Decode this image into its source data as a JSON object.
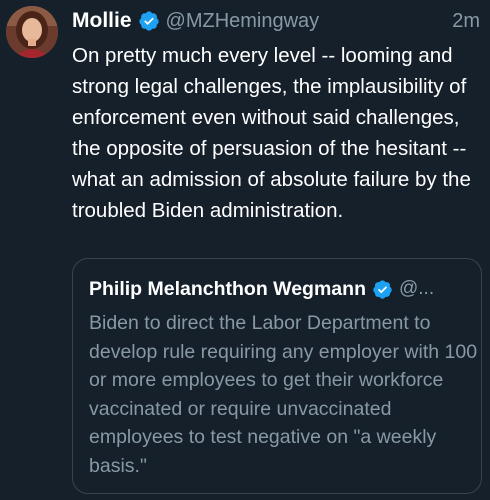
{
  "tweet": {
    "author_name": "Mollie",
    "handle": "@MZHemingway",
    "time": "2m",
    "text": "On pretty much every level -- looming and strong legal challenges, the implausibility of enforcement even without said challenges, the opposite of persuasion of the hesitant -- what an admission of absolute failure by the troubled Biden administration.",
    "avatar_icon": "user-avatar",
    "verified_icon": "verified-badge-icon"
  },
  "quoted_tweet": {
    "author_name": "Philip Melanchthon Wegmann",
    "handle": "@...",
    "text": "Biden to direct the Labor Department to develop rule  requiring any employer with 100 or more employees to get their workforce vaccinated or require unvaccinated employees to test negative on \"a weekly basis.\"",
    "verified_icon": "verified-badge-icon"
  },
  "colors": {
    "background": "#15202b",
    "primary_text": "#ffffff",
    "secondary_text": "#8899a6",
    "verified": "#1da1f2",
    "border": "#38444d"
  }
}
